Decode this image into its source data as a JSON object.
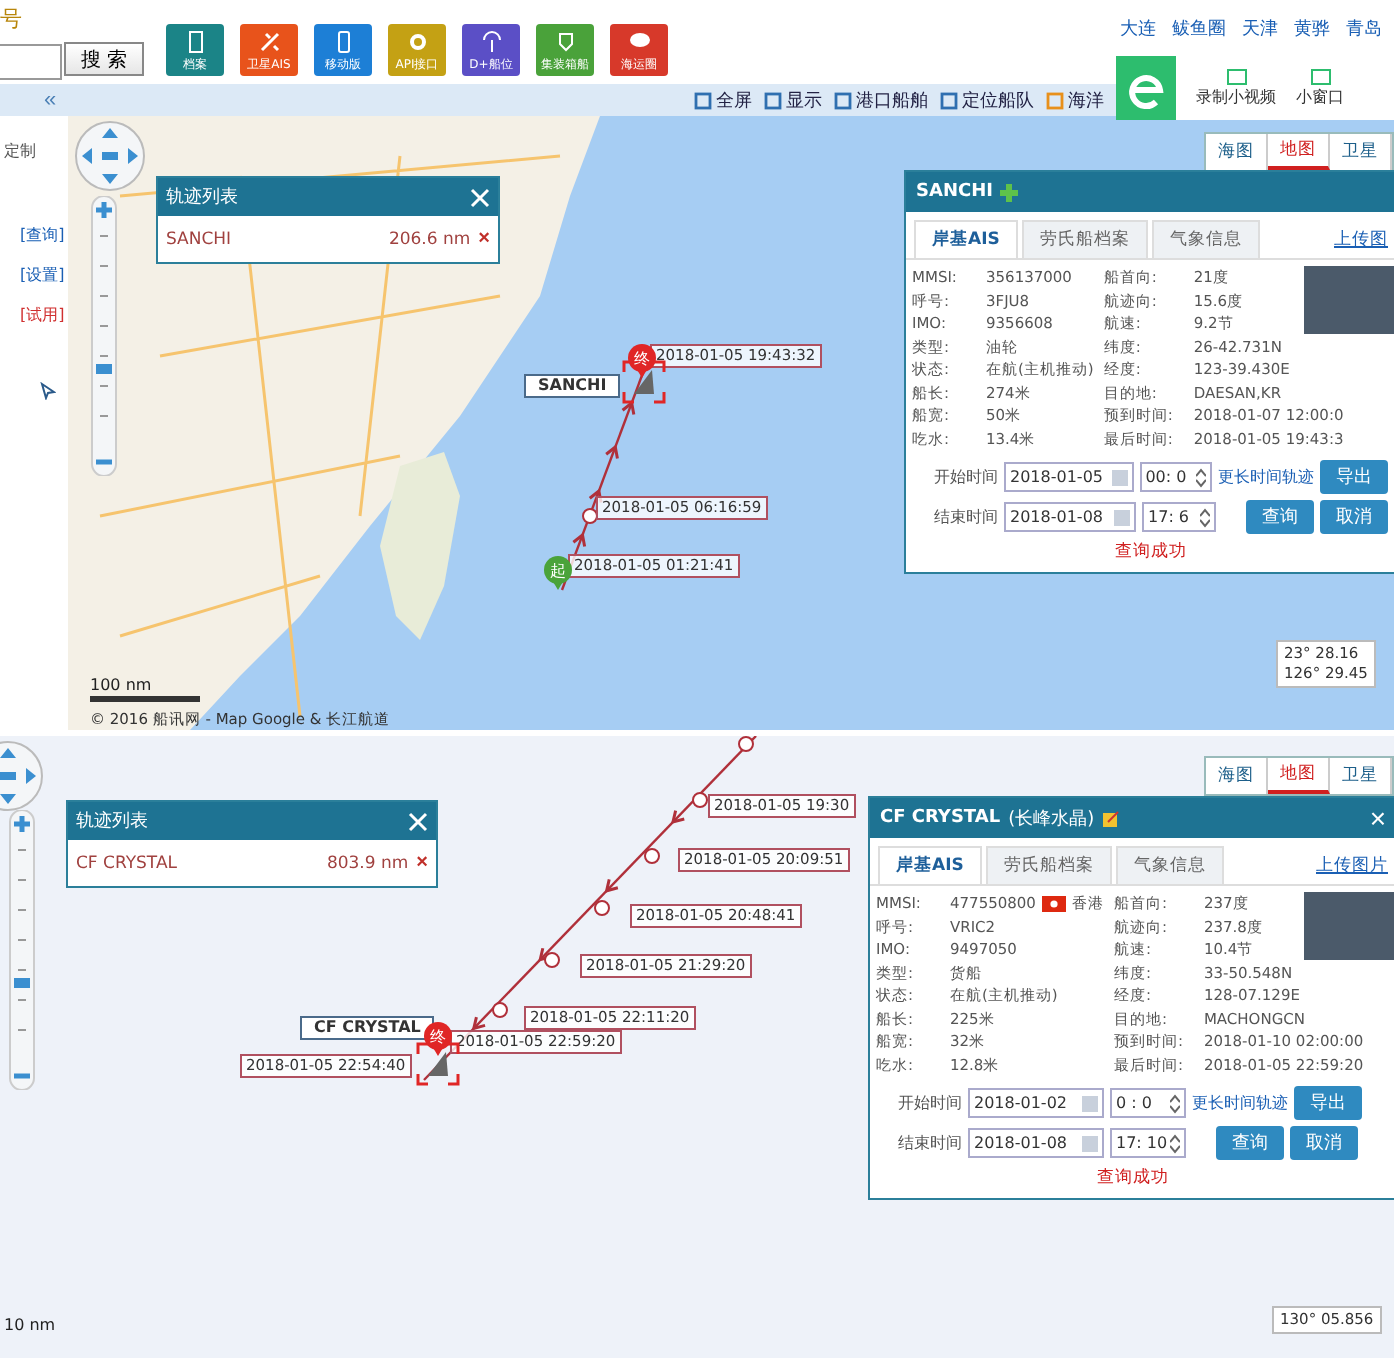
{
  "header": {
    "label_partial": "号",
    "search_button": "搜 索",
    "apps": [
      {
        "label": "档案",
        "color": "#1b8487"
      },
      {
        "label": "卫星AIS",
        "color": "#e8531b"
      },
      {
        "label": "移动版",
        "color": "#1d7fd6"
      },
      {
        "label": "API接口",
        "color": "#c4a114"
      },
      {
        "label": "D+船位",
        "color": "#5b4fc6"
      },
      {
        "label": "集装箱船",
        "color": "#4aa23a"
      },
      {
        "label": "海运圈",
        "color": "#d7392a"
      }
    ],
    "city_links": [
      "大连",
      "鲅鱼圈",
      "天津",
      "黄骅",
      "青岛"
    ],
    "browser_tools": [
      "录制小视频",
      "小窗口"
    ]
  },
  "toolbar": {
    "collapse": "«",
    "items": [
      "全屏",
      "显示",
      "港口船舶",
      "定位船队",
      "海洋"
    ]
  },
  "maps": [
    {
      "sidebar": {
        "title": "定制",
        "links": [
          "[查询]",
          "[设置]",
          "[试用]"
        ]
      },
      "zoom": {
        "level": 0.4
      },
      "map_types": [
        {
          "label": "海图",
          "selected": false
        },
        {
          "label": "地图",
          "selected": true
        },
        {
          "label": "卫星",
          "selected": false
        }
      ],
      "track_list": {
        "title": "轨迹列表",
        "items": [
          {
            "name": "SANCHI",
            "distance": "206.6 nm",
            "remove": "×"
          }
        ]
      },
      "ship_label": "SANCHI",
      "end_marker": "终",
      "start_marker": "起",
      "track_labels": [
        "2018-01-05 19:43:32",
        "2018-01-05 06:16:59",
        "2018-01-05 01:21:41"
      ],
      "ship_panel": {
        "title": "SANCHI",
        "tabs": [
          {
            "label": "岸基AIS",
            "selected": true
          },
          {
            "label": "劳氏船档案",
            "selected": false
          },
          {
            "label": "气象信息",
            "selected": false
          }
        ],
        "upload_link": "上传图",
        "fields_left": [
          {
            "label": "MMSI:",
            "value": "356137000"
          },
          {
            "label": "呼号:",
            "value": "3FJU8"
          },
          {
            "label": "IMO:",
            "value": "9356608"
          },
          {
            "label": "类型:",
            "value": "油轮"
          },
          {
            "label": "状态:",
            "value": "在航(主机推动)"
          },
          {
            "label": "船长:",
            "value": "274米"
          },
          {
            "label": "船宽:",
            "value": "50米"
          },
          {
            "label": "吃水:",
            "value": "13.4米"
          }
        ],
        "fields_right": [
          {
            "label": "船首向:",
            "value": "21度"
          },
          {
            "label": "航迹向:",
            "value": "15.6度"
          },
          {
            "label": "航速:",
            "value": "9.2节"
          },
          {
            "label": "纬度:",
            "value": "26-42.731N"
          },
          {
            "label": "经度:",
            "value": "123-39.430E"
          },
          {
            "label": "目的地:",
            "value": "DAESAN,KR"
          },
          {
            "label": "预到时间:",
            "value": "2018-01-07 12:00:0"
          },
          {
            "label": "最后时间:",
            "value": "2018-01-05 19:43:3"
          }
        ],
        "start_label": "开始时间",
        "start_date": "2018-01-05",
        "start_time": "00: 0",
        "end_label": "结束时间",
        "end_date": "2018-01-08",
        "end_time": "17: 6",
        "long_track_link": "更长时间轨迹",
        "export_button": "导出",
        "query_button": "查询",
        "cancel_button": "取消",
        "status": "查询成功"
      },
      "scale": "100 nm",
      "copyright": "© 2016 船讯网 - Map Google & 长江航道",
      "coords": [
        "23° 28.16",
        "126° 29.45"
      ]
    },
    {
      "zoom": {
        "level": 0.4
      },
      "map_types": [
        {
          "label": "海图",
          "selected": false
        },
        {
          "label": "地图",
          "selected": true
        },
        {
          "label": "卫星",
          "selected": false
        }
      ],
      "track_list": {
        "title": "轨迹列表",
        "items": [
          {
            "name": "CF CRYSTAL",
            "distance": "803.9 nm",
            "remove": "×"
          }
        ]
      },
      "ship_label": "CF CRYSTAL",
      "end_marker": "终",
      "track_labels": [
        "2018-01-05 19:30",
        "2018-01-05 20:09:51",
        "2018-01-05 20:48:41",
        "2018-01-05 21:29:20",
        "2018-01-05 22:11:20",
        "2018-01-05 22:59:20",
        "2018-01-05 22:54:40"
      ],
      "ship_panel": {
        "title": "CF CRYSTAL",
        "subtitle": "(长峰水晶)",
        "close": "×",
        "tabs": [
          {
            "label": "岸基AIS",
            "selected": true
          },
          {
            "label": "劳氏船档案",
            "selected": false
          },
          {
            "label": "气象信息",
            "selected": false
          }
        ],
        "upload_link": "上传图片",
        "fields_left": [
          {
            "label": "MMSI:",
            "value": "477550800",
            "flag": "香港"
          },
          {
            "label": "呼号:",
            "value": "VRIC2"
          },
          {
            "label": "IMO:",
            "value": "9497050"
          },
          {
            "label": "类型:",
            "value": "货船"
          },
          {
            "label": "状态:",
            "value": "在航(主机推动)"
          },
          {
            "label": "船长:",
            "value": "225米"
          },
          {
            "label": "船宽:",
            "value": "32米"
          },
          {
            "label": "吃水:",
            "value": "12.8米"
          }
        ],
        "fields_right": [
          {
            "label": "船首向:",
            "value": "237度"
          },
          {
            "label": "航迹向:",
            "value": "237.8度"
          },
          {
            "label": "航速:",
            "value": "10.4节"
          },
          {
            "label": "纬度:",
            "value": "33-50.548N"
          },
          {
            "label": "经度:",
            "value": "128-07.129E"
          },
          {
            "label": "目的地:",
            "value": "MACHONGCN"
          },
          {
            "label": "预到时间:",
            "value": "2018-01-10 02:00:00"
          },
          {
            "label": "最后时间:",
            "value": "2018-01-05 22:59:20"
          }
        ],
        "start_label": "开始时间",
        "start_date": "2018-01-02",
        "start_time": "0 : 0",
        "end_label": "结束时间",
        "end_date": "2018-01-08",
        "end_time": "17: 10",
        "long_track_link": "更长时间轨迹",
        "export_button": "导出",
        "query_button": "查询",
        "cancel_button": "取消",
        "status": "查询成功"
      },
      "scale": "10 nm",
      "coords": [
        "130° 05.856"
      ]
    }
  ]
}
